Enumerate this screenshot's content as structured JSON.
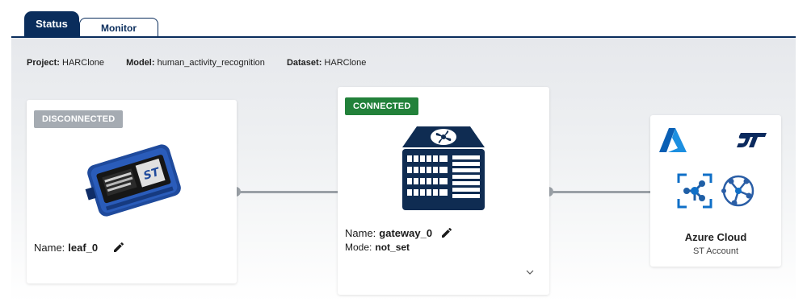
{
  "tabs": [
    {
      "label": "Status",
      "active": true
    },
    {
      "label": "Monitor",
      "active": false
    }
  ],
  "info": {
    "project_label": "Project:",
    "project_value": "HARClone",
    "model_label": "Model:",
    "model_value": "human_activity_recognition",
    "dataset_label": "Dataset:",
    "dataset_value": "HARClone"
  },
  "leaf": {
    "status": "DISCONNECTED",
    "name_label": "Name:",
    "name_value": "leaf_0"
  },
  "gateway": {
    "status": "CONNECTED",
    "name_label": "Name:",
    "name_value": "gateway_0",
    "mode_label": "Mode:",
    "mode_value": "not_set",
    "expand_icon": "chevron-down-icon"
  },
  "cloud": {
    "title": "Azure Cloud",
    "subtitle": "ST Account",
    "logos": [
      "azure-logo",
      "st-logo",
      "iot-hub-icon",
      "iot-central-icon"
    ]
  },
  "colors": {
    "brand_navy": "#0a2d5c",
    "connected_green": "#22813a",
    "disconnected_gray": "#a5abb2",
    "azure_blue": "#0078d4"
  }
}
